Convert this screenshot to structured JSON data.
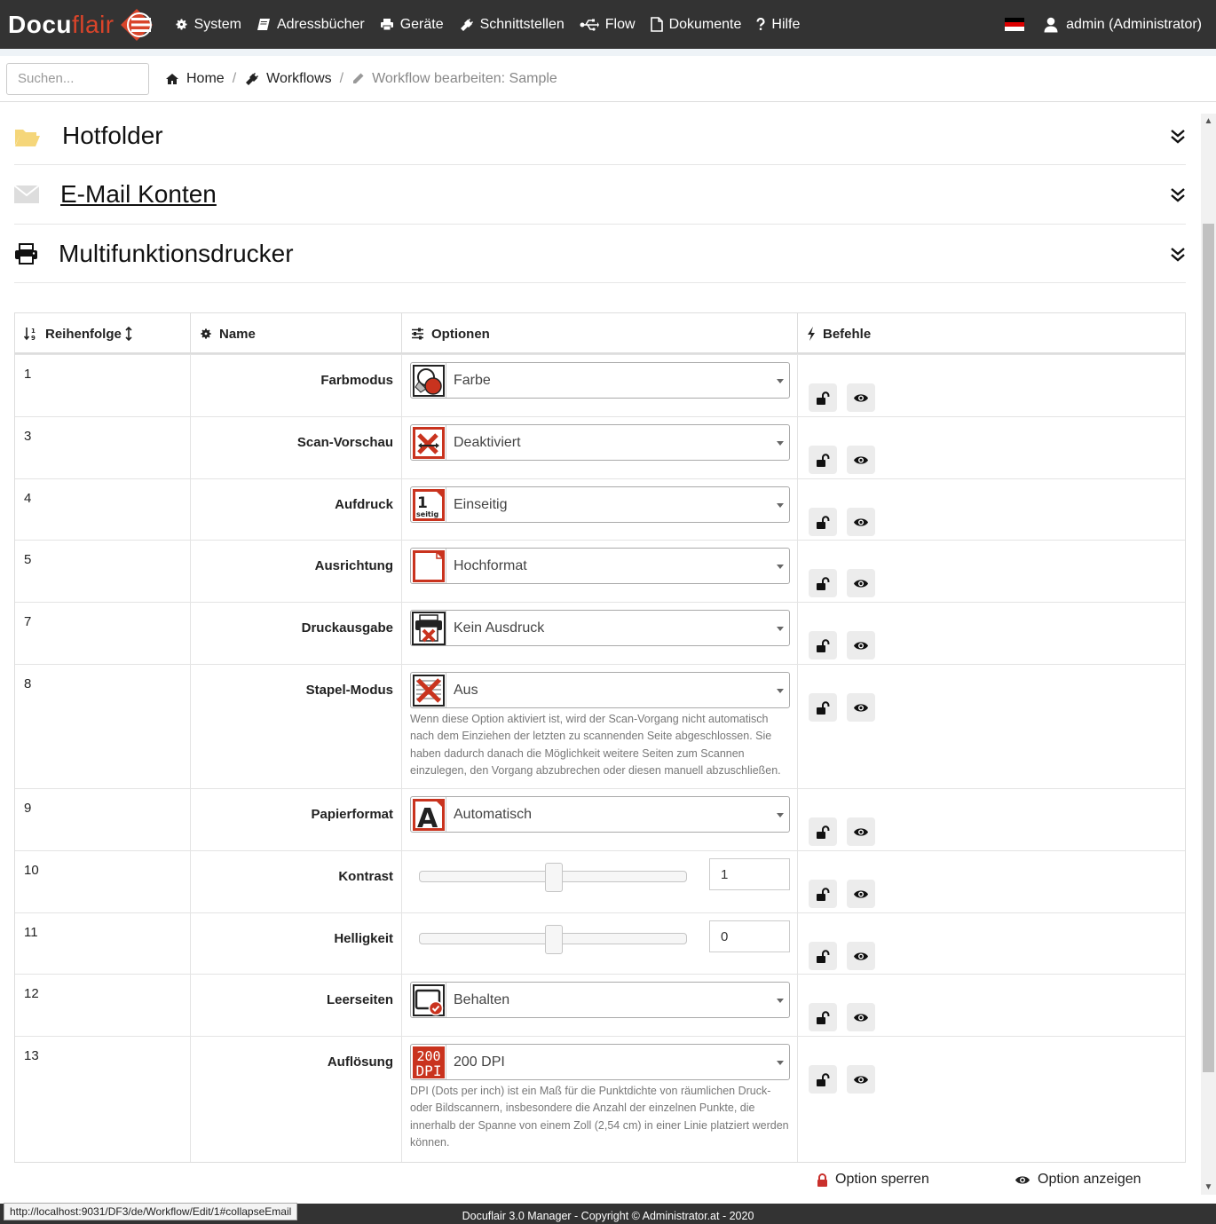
{
  "app": {
    "logo_main": "Docu",
    "logo_accent": "flair"
  },
  "nav": {
    "items": [
      {
        "label": "System",
        "icon": "gear-icon"
      },
      {
        "label": "Adressbücher",
        "icon": "book-icon"
      },
      {
        "label": "Geräte",
        "icon": "printer-icon"
      },
      {
        "label": "Schnittstellen",
        "icon": "plug-icon"
      },
      {
        "label": "Flow",
        "icon": "usb-icon"
      },
      {
        "label": "Dokumente",
        "icon": "file-icon"
      },
      {
        "label": "Hilfe",
        "icon": "question-icon"
      }
    ],
    "user": "admin (Administrator)"
  },
  "search": {
    "placeholder": "Suchen..."
  },
  "breadcrumb": {
    "home": "Home",
    "workflows": "Workflows",
    "current": "Workflow bearbeiten: Sample"
  },
  "sections": {
    "hotfolder": "Hotfolder",
    "email": "E-Mail Konten",
    "mfp": "Multifunktionsdrucker"
  },
  "table": {
    "headers": {
      "order": "Reihenfolge",
      "name": "Name",
      "options": "Optionen",
      "commands": "Befehle"
    },
    "rows": [
      {
        "order": "1",
        "name": "Farbmodus",
        "value": "Farbe",
        "icon": "color-mode-icon"
      },
      {
        "order": "3",
        "name": "Scan-Vorschau",
        "value": "Deaktiviert",
        "icon": "scan-preview-icon"
      },
      {
        "order": "4",
        "name": "Aufdruck",
        "value": "Einseitig",
        "icon": "single-sided-icon",
        "icon_text": "1",
        "icon_sub": "seitig"
      },
      {
        "order": "5",
        "name": "Ausrichtung",
        "value": "Hochformat",
        "icon": "portrait-icon"
      },
      {
        "order": "7",
        "name": "Druckausgabe",
        "value": "Kein Ausdruck",
        "icon": "no-print-icon"
      },
      {
        "order": "8",
        "name": "Stapel-Modus",
        "value": "Aus",
        "icon": "batch-off-icon",
        "help": "Wenn diese Option aktiviert ist, wird der Scan-Vorgang nicht automatisch nach dem Einziehen der letzten zu scannenden Seite abgeschlossen. Sie haben dadurch danach die Möglichkeit weitere Seiten zum Scannen einzulegen, den Vorgang abzubrechen oder diesen manuell abzuschließen."
      },
      {
        "order": "9",
        "name": "Papierformat",
        "value": "Automatisch",
        "icon": "paper-format-icon",
        "icon_text": "A"
      },
      {
        "order": "10",
        "name": "Kontrast",
        "value": "1",
        "slider": 0.5
      },
      {
        "order": "11",
        "name": "Helligkeit",
        "value": "0",
        "slider": 0.5
      },
      {
        "order": "12",
        "name": "Leerseiten",
        "value": "Behalten",
        "icon": "blank-pages-icon"
      },
      {
        "order": "13",
        "name": "Auflösung",
        "value": "200 DPI",
        "icon": "dpi-icon",
        "icon_text": "200",
        "icon_sub": "DPI",
        "help": "DPI (Dots per inch) ist ein Maß für die Punktdichte von räumlichen Druck- oder Bildscannern, insbesondere die Anzahl der einzelnen Punkte, die innerhalb der Spanne von einem Zoll (2,54 cm) in einer Linie platziert werden können."
      }
    ]
  },
  "legend": {
    "lock": "Option sperren",
    "show": "Option anzeigen"
  },
  "footer": "Docuflair 3.0 Manager - Copyright © Administrator.at - 2020",
  "status_url": "http://localhost:9031/DF3/de/Workflow/Edit/1#collapseEmail",
  "colors": {
    "brand": "#d9442a",
    "nav_bg": "#333333",
    "folder": "#f5d67a"
  }
}
